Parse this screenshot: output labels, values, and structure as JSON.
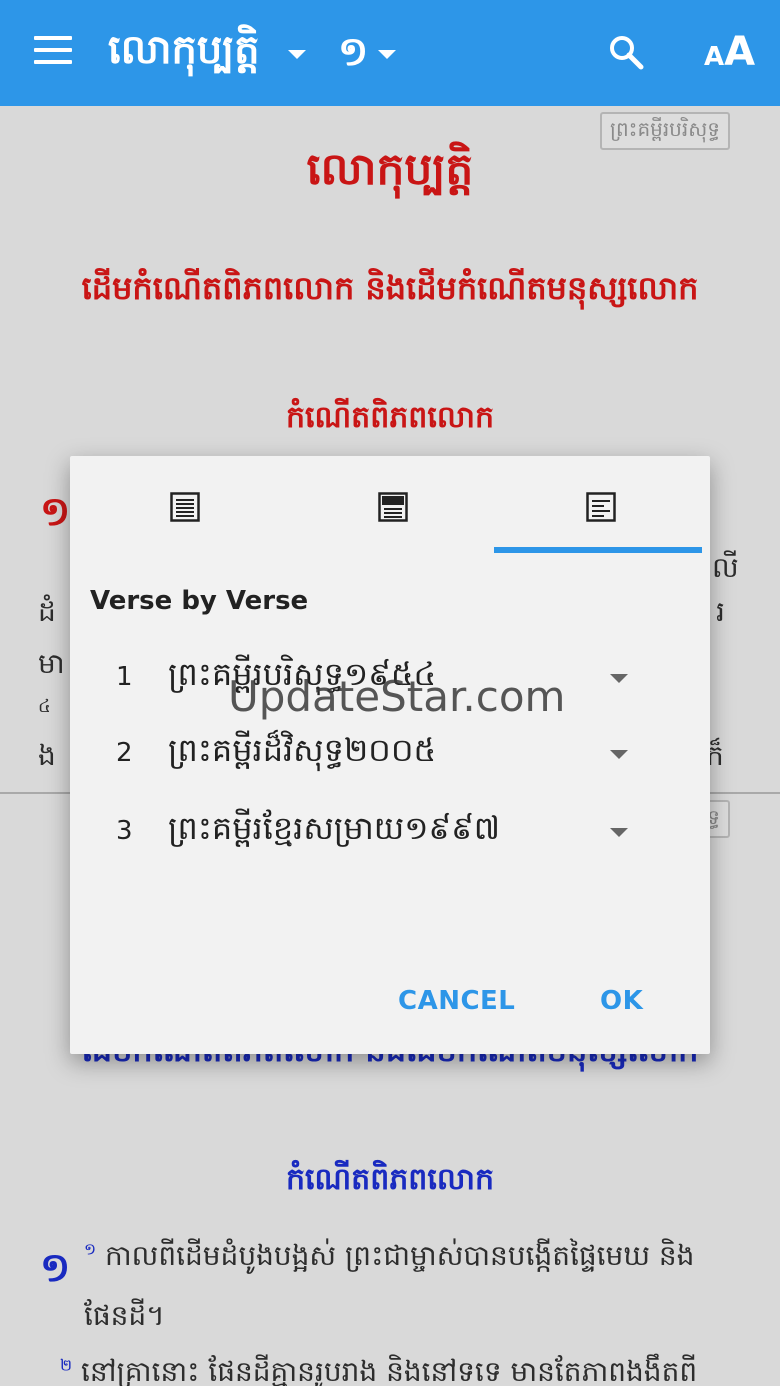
{
  "appbar": {
    "book": "លោកុប្បត្តិ",
    "chapter": "១",
    "font_button": "A",
    "font_button_small": "A"
  },
  "top_panel": {
    "version_tag": "ព្រះគម្ពីរបរិសុទ្ធ",
    "book_title": "លោកុប្បត្តិ",
    "section_title": "ដើមកំណើតពិភពលោក និងដើមកំណើតមនុស្សលោក",
    "subheading": "កំណើតពិភពលោក",
    "verse_number": "១",
    "text_fragments": [
      "លី",
      "ដំ",
      "រ",
      "មា",
      "៤",
      "ង",
      "ក៏"
    ]
  },
  "bottom_panel": {
    "version_tag": "ព្រះគម្ពីរបរិសុទ្ធ",
    "section_title": "ដើមកំណើតពិភពលោក និងដើមកំណើតមនុស្សលោក",
    "subheading": "កំណើតពិភពលោក",
    "verse_number": "១",
    "verse1_sup": "១",
    "verse1_line1": "កាលពីដើមដំបូងបង្អស់ ព្រះជាម្ចាស់បានបង្កើតផ្ទៃមេឃ និង",
    "verse1_line2": "ផែនដី។",
    "verse2_sup": "២",
    "verse2_line1": "នៅគ្រានោះ ផែនដីគ្មានរូបរាង និងនៅទទេ មានតែភាពងងឹតពី"
  },
  "dialog": {
    "tabs": [
      {
        "icon": "single-column-layout-icon"
      },
      {
        "icon": "parallel-layout-icon"
      },
      {
        "icon": "verse-by-verse-layout-icon",
        "selected": true
      }
    ],
    "title": "Verse by Verse",
    "rows": [
      {
        "num": "1",
        "name": "ព្រះគម្ពីរបរិសុទ្ធ១៩៥៤"
      },
      {
        "num": "2",
        "name": "ព្រះគម្ពីរដ៏វិសុទ្ធ២០០៥"
      },
      {
        "num": "3",
        "name": "ព្រះគម្ពីរខ្មែរសម្រាយ១៩៩៧"
      }
    ],
    "cancel": "CANCEL",
    "ok": "OK"
  },
  "watermark": "UpdateStar.com",
  "colors": {
    "primary": "#2d96e8",
    "heading_red": "#e01818",
    "heading_blue": "#1c2fd6"
  }
}
